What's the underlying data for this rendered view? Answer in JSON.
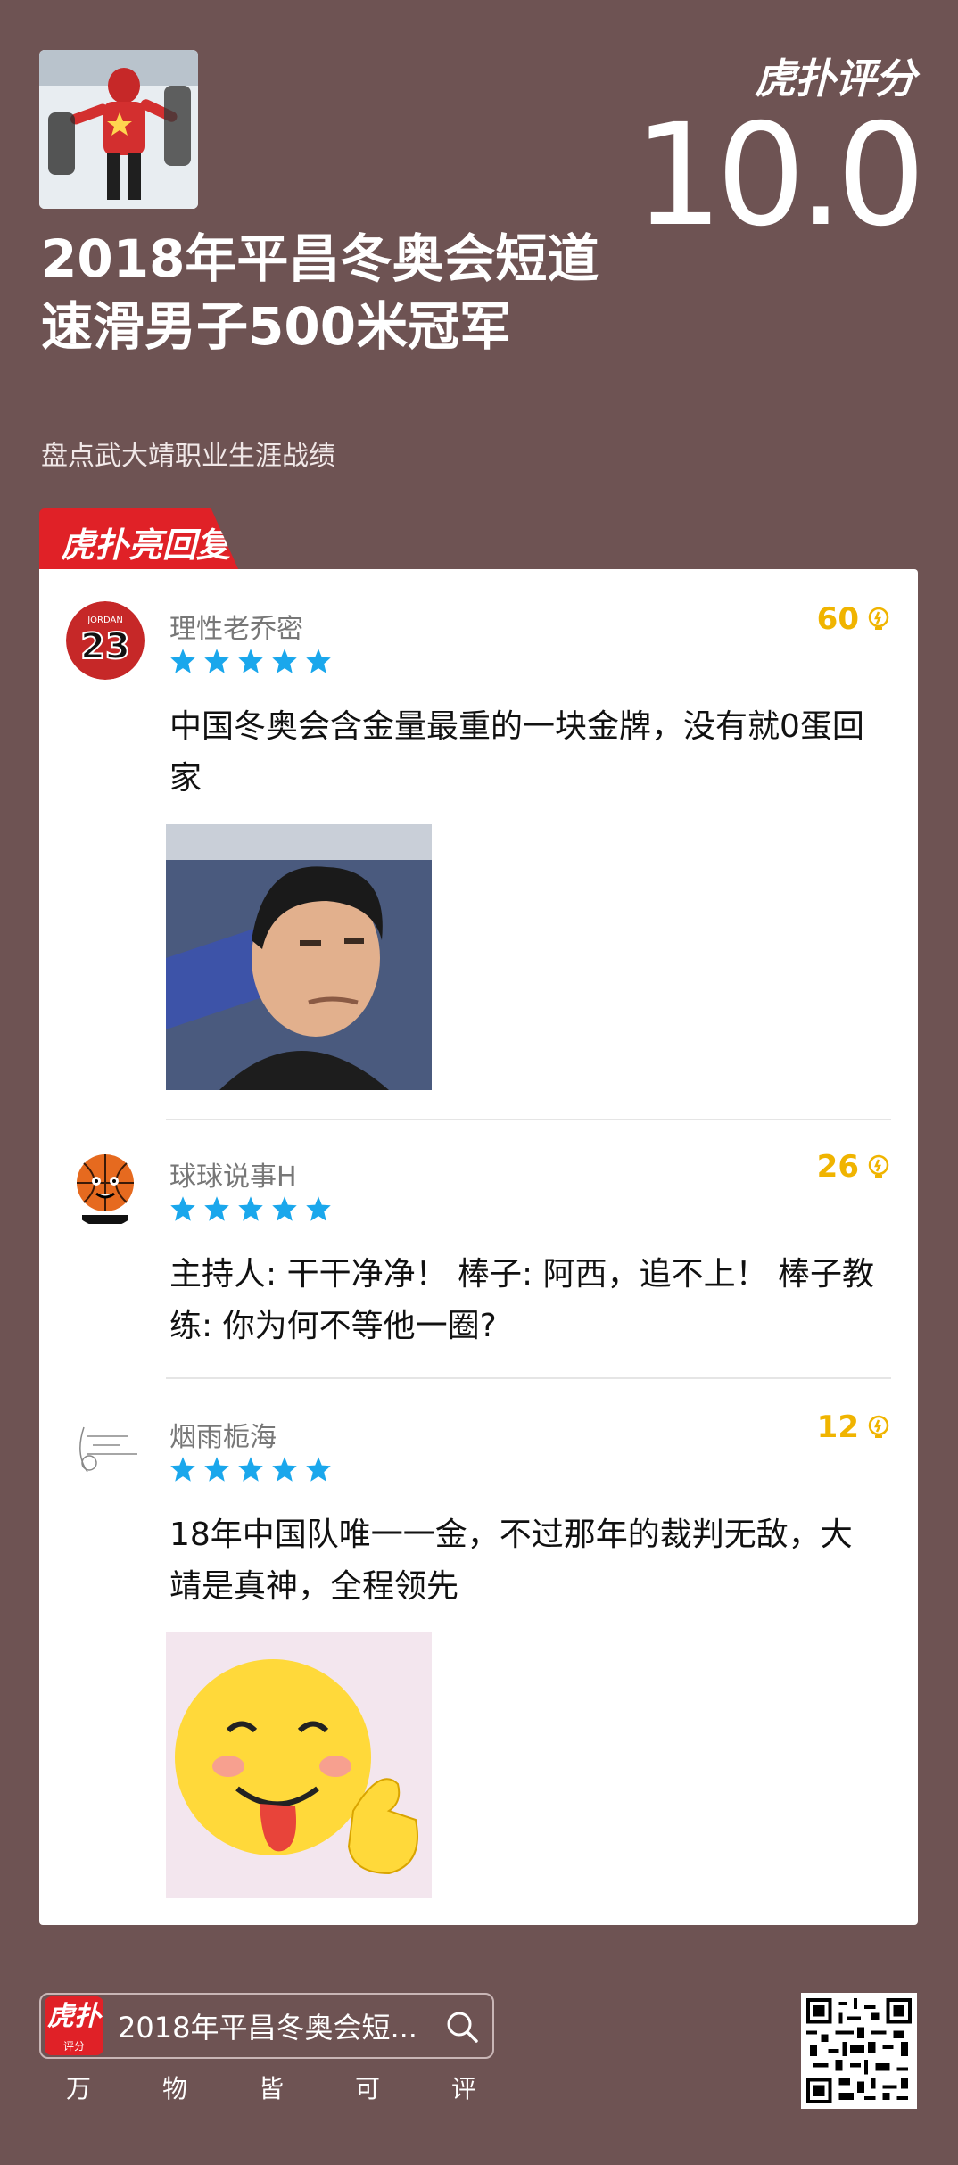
{
  "header": {
    "brand": "虎扑评分",
    "score": "10.0",
    "title": "2018年平昌冬奥会短道速滑男子500米冠军",
    "subtitle": "盘点武大靖职业生涯战绩",
    "thumbnail": "speed-skater-photo"
  },
  "section_tag": "虎扑亮回复",
  "comments": [
    {
      "user": "理性老乔密",
      "avatar": "jordan-23-jersey",
      "stars": 5,
      "likes": "60",
      "text": "中国冬奥会含金量最重的一块金牌，没有就0蛋回家",
      "image": "yao-ming-face-photo"
    },
    {
      "user": "球球说事H",
      "avatar": "basketball-cartoon",
      "stars": 5,
      "likes": "26",
      "text": "主持人: 干干净净！  棒子: 阿西，追不上！  棒子教练: 你为何不等他一圈?"
    },
    {
      "user": "烟雨栀海",
      "avatar": "sketch-drawing",
      "stars": 5,
      "likes": "12",
      "text": "18年中国队唯一一金，不过那年的裁判无敌，大靖是真神，全程领先",
      "image": "tongue-out-thumbs-up-emoji"
    }
  ],
  "footer": {
    "logo_text": "虎扑",
    "logo_sub": "评分",
    "search_text": "2018年平昌冬奥会短...",
    "slogan": [
      "万",
      "物",
      "皆",
      "可",
      "评"
    ],
    "qr": "qr-code"
  },
  "colors": {
    "background": "#6e5353",
    "accent_red": "#e02127",
    "star_blue": "#1aa7ec",
    "likes_gold": "#f0b400"
  }
}
